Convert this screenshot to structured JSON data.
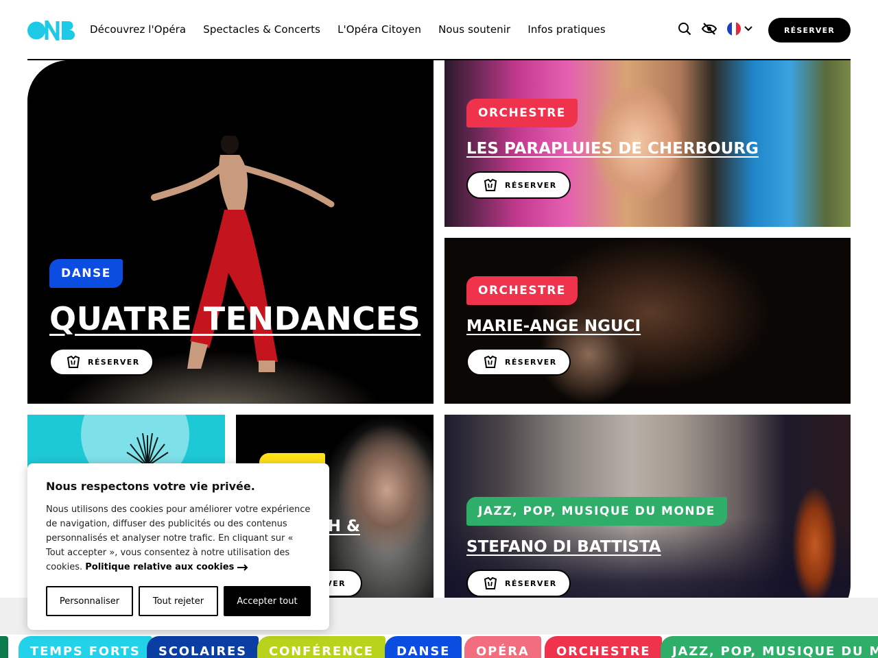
{
  "header": {
    "logo_label": "ONB",
    "nav": [
      "Découvrez l'Opéra",
      "Spectacles & Concerts",
      "L'Opéra Citoyen",
      "Nous soutenir",
      "Infos pratiques"
    ],
    "reserve_label": "RÉSERVER",
    "icons": [
      "search-icon",
      "eye-off-icon",
      "flag-fr-icon",
      "chevron-down-icon"
    ]
  },
  "cards": {
    "danse": {
      "tag": "DANSE",
      "title": "QUATRE TENDANCES",
      "button": "RÉSERVER"
    },
    "parapluies": {
      "tag": "ORCHESTRE",
      "title": "LES PARAPLUIES DE CHERBOURG",
      "button": "RÉSERVER"
    },
    "nguci": {
      "tag": "ORCHESTRE",
      "title": "MARIE-ANGE NGUCI",
      "button": "RÉSERVER"
    },
    "argerich": {
      "title_partial": "RH &",
      "button_partial": "VER"
    },
    "battista": {
      "tag": "JAZZ, POP, MUSIQUE DU MONDE",
      "title": "STEFANO DI BATTISTA",
      "button": "RÉSERVER"
    }
  },
  "cookie": {
    "title": "Nous respectons votre vie privée.",
    "text": "Nous utilisons des cookies pour améliorer votre expérience de navigation, diffuser des publicités ou des contenus personnalisés et analyser notre trafic. En cliquant sur « Tout accepter », vous consentez à notre utilisation des cookies.",
    "policy_link": "Politique relative aux cookies",
    "btn_customize": "Personnaliser",
    "btn_reject": "Tout rejeter",
    "btn_accept": "Accepter tout"
  },
  "categories": [
    "TEMPS FORTS",
    "SCOLAIRES",
    "CONFÉRENCE",
    "DANSE",
    "OPÉRA",
    "ORCHESTRE",
    "JAZZ, POP, MUSIQUE DU MONDE"
  ],
  "colors": {
    "brand_cyan": "#1ec9e6",
    "danse_blue": "#0a4de0",
    "orchestre_red": "#f0334d",
    "jazz_green": "#2fae6a",
    "temps_forts": "#21d2e8",
    "scolaires": "#0b3ea3",
    "conference": "#b9d31c",
    "danse_cat": "#0a4de0",
    "opera": "#f26d7d",
    "orchestre_cat": "#f0334d",
    "jazz_cat": "#2fae6a",
    "argerich_yellow": "#ffe11a"
  }
}
